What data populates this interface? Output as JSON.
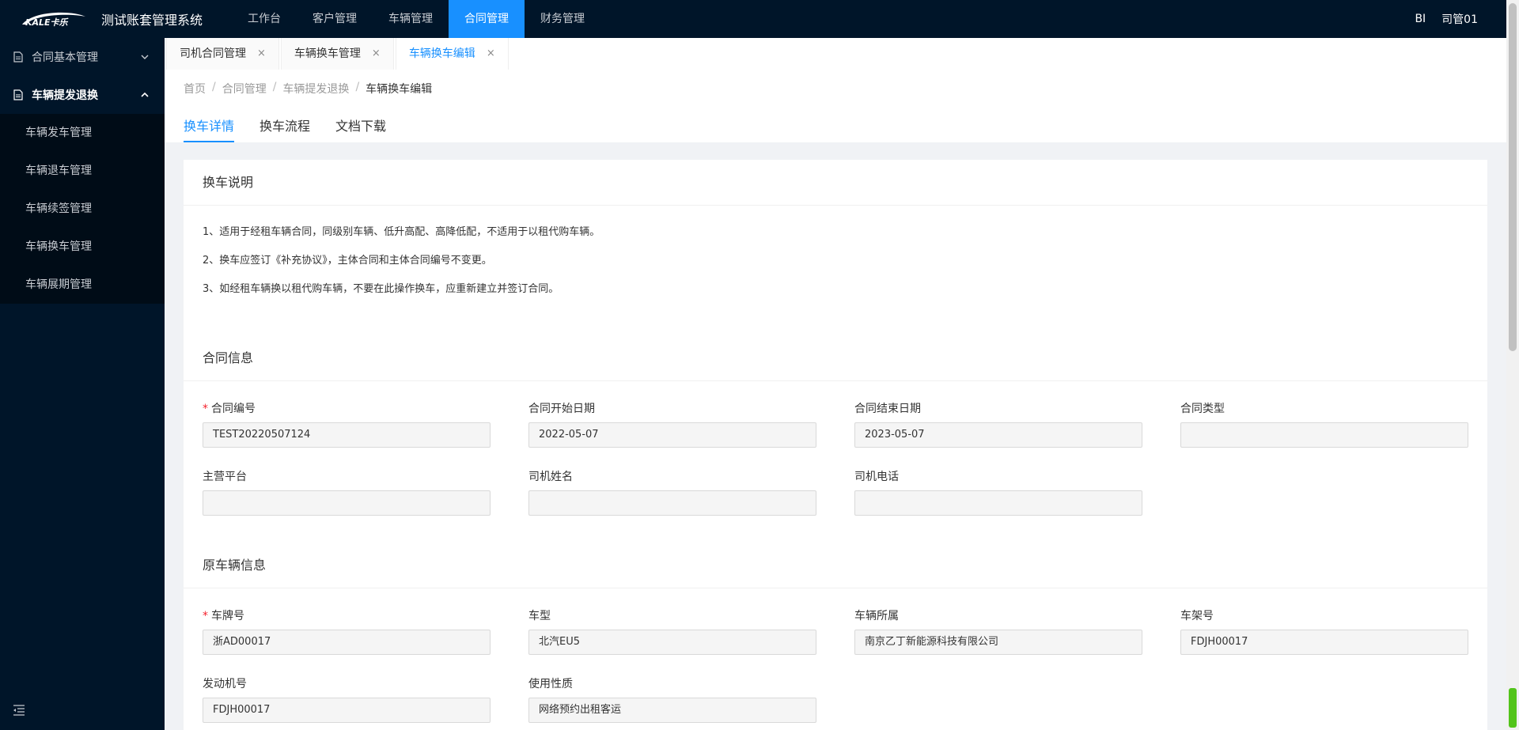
{
  "header": {
    "logo_text": "KALE卡乐",
    "app_title": "测试账套管理系统",
    "nav": [
      {
        "label": "工作台"
      },
      {
        "label": "客户管理"
      },
      {
        "label": "车辆管理"
      },
      {
        "label": "合同管理"
      },
      {
        "label": "财务管理"
      }
    ],
    "bi_label": "BI",
    "user_name": "司管01"
  },
  "sidebar": {
    "groups": [
      {
        "label": "合同基本管理",
        "icon": "document-icon",
        "expanded": false
      },
      {
        "label": "车辆提发退换",
        "icon": "document-icon",
        "expanded": true
      }
    ],
    "sub_items": [
      {
        "label": "车辆发车管理"
      },
      {
        "label": "车辆退车管理"
      },
      {
        "label": "车辆续签管理"
      },
      {
        "label": "车辆换车管理"
      },
      {
        "label": "车辆展期管理"
      }
    ]
  },
  "page_tabs": [
    {
      "label": "司机合同管理"
    },
    {
      "label": "车辆换车管理"
    },
    {
      "label": "车辆换车编辑"
    }
  ],
  "breadcrumb": [
    "首页",
    "合同管理",
    "车辆提发退换",
    "车辆换车编辑"
  ],
  "breadcrumb_sep": "/",
  "inner_tabs": [
    {
      "label": "换车详情"
    },
    {
      "label": "换车流程"
    },
    {
      "label": "文档下载"
    }
  ],
  "notes": {
    "title": "换车说明",
    "lines": [
      "1、适用于经租车辆合同，同级别车辆、低升高配、高降低配，不适用于以租代购车辆。",
      "2、换车应签订《补充协议》，主体合同和主体合同编号不变更。",
      "3、如经租车辆换以租代购车辆，不要在此操作换车，应重新建立并签订合同。"
    ]
  },
  "contract": {
    "title": "合同信息",
    "fields": [
      {
        "label": "合同编号",
        "value": "TEST20220507124",
        "required": true
      },
      {
        "label": "合同开始日期",
        "value": "2022-05-07"
      },
      {
        "label": "合同结束日期",
        "value": "2023-05-07"
      },
      {
        "label": "合同类型",
        "value": ""
      },
      {
        "label": "主营平台",
        "value": ""
      },
      {
        "label": "司机姓名",
        "value": ""
      },
      {
        "label": "司机电话",
        "value": ""
      }
    ]
  },
  "vehicle": {
    "title": "原车辆信息",
    "fields": [
      {
        "label": "车牌号",
        "value": "浙AD00017",
        "required": true
      },
      {
        "label": "车型",
        "value": "北汽EU5"
      },
      {
        "label": "车辆所属",
        "value": "南京乙丁新能源科技有限公司"
      },
      {
        "label": "车架号",
        "value": "FDJH00017"
      },
      {
        "label": "发动机号",
        "value": "FDJH00017"
      },
      {
        "label": "使用性质",
        "value": "网络预约出租客运"
      }
    ]
  },
  "required_mark": "*",
  "close_glyph": "×",
  "colors": {
    "primary": "#1890ff",
    "nav_bg": "#001529",
    "required": "#f5222d"
  }
}
